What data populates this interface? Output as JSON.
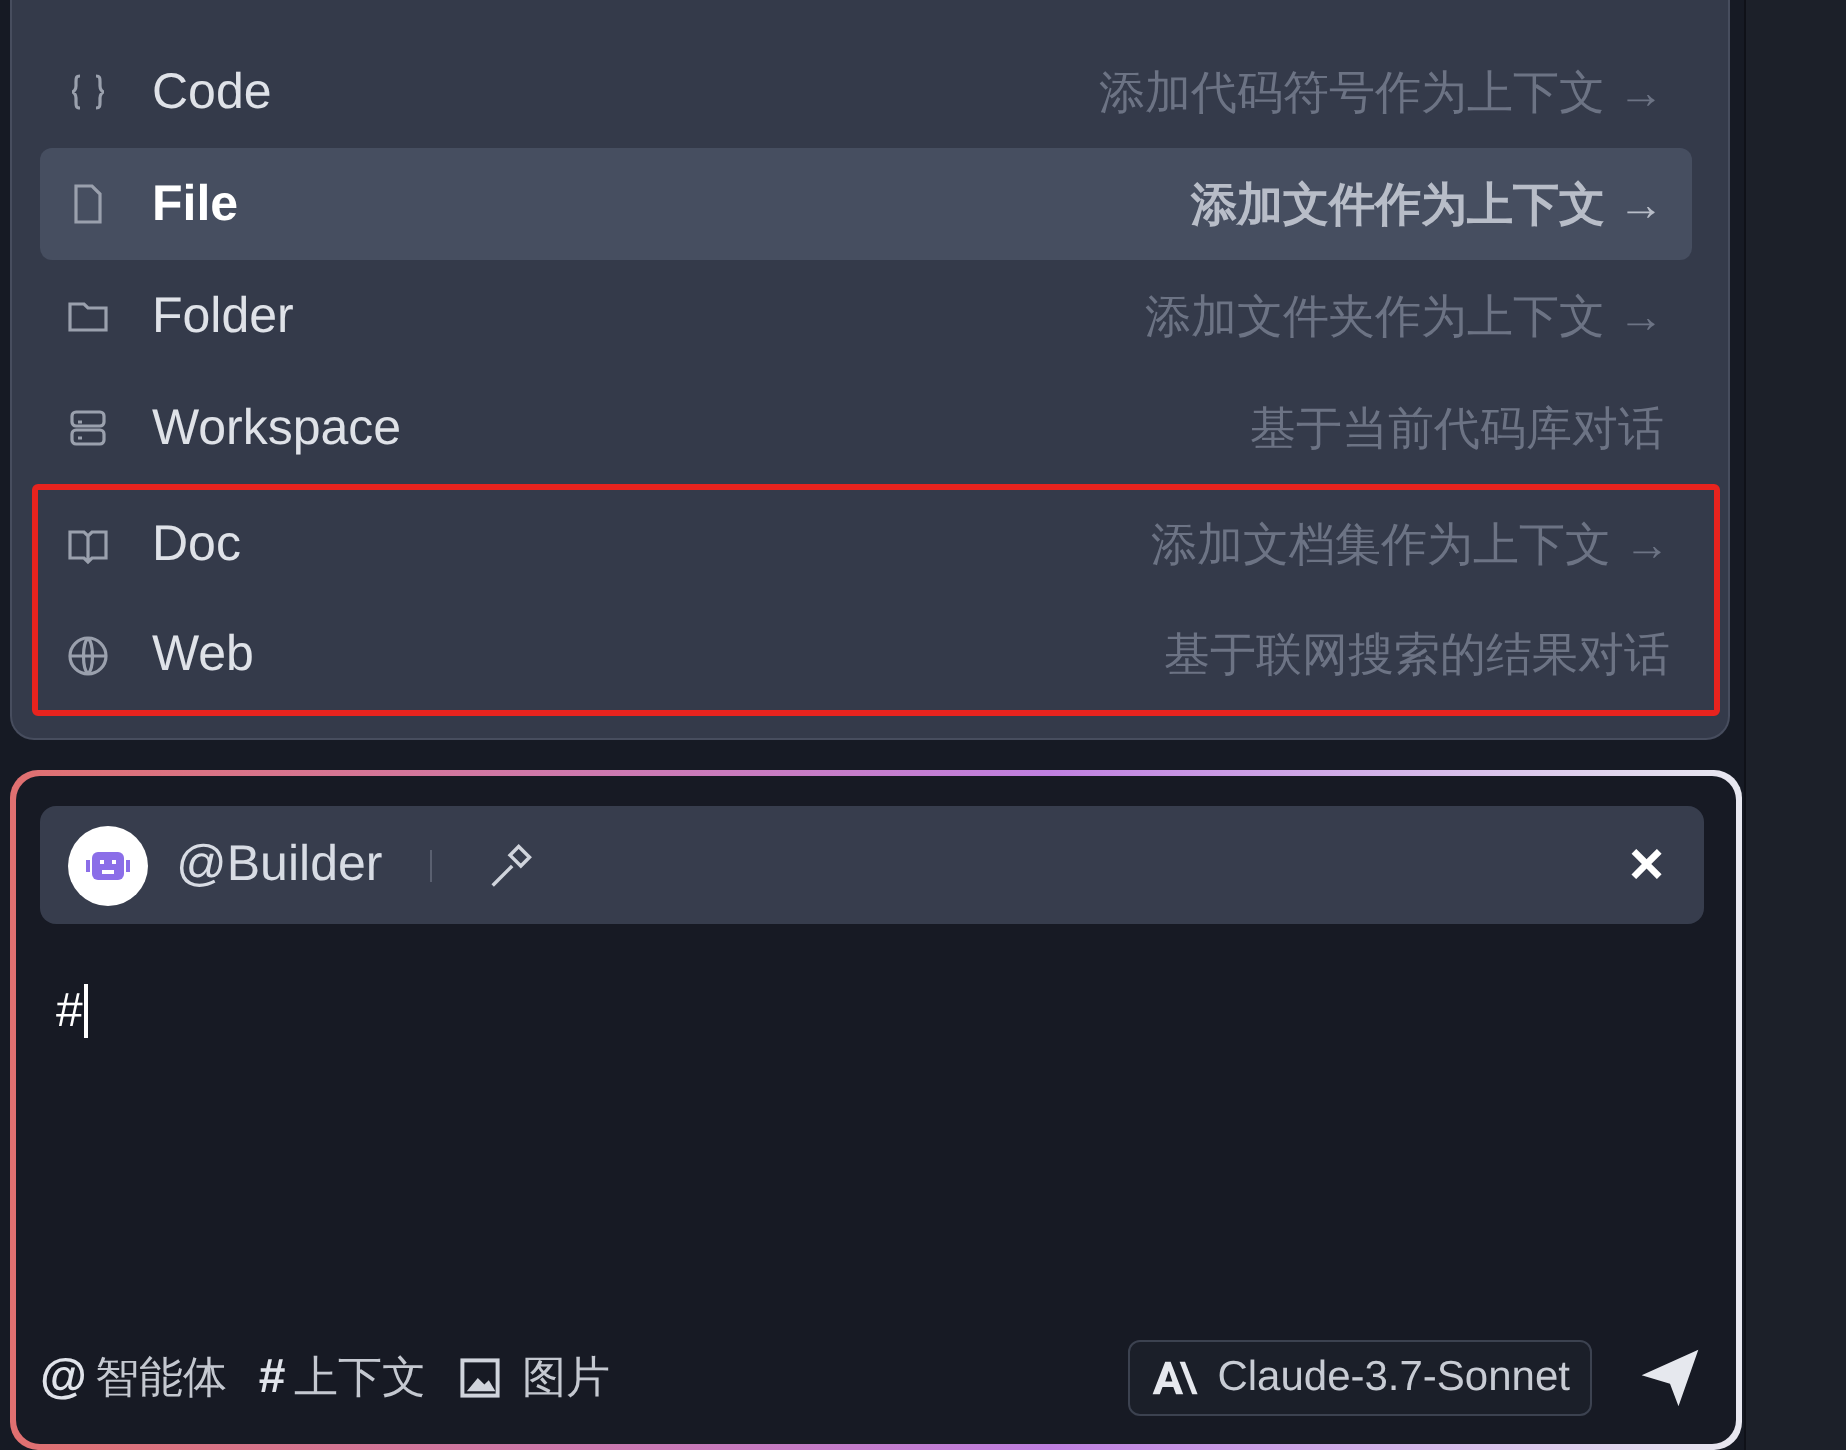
{
  "menu": {
    "items": [
      {
        "kind": "code",
        "label": "Code",
        "hint": "添加代码符号作为上下文",
        "arrow": "→",
        "selected": false,
        "highlighted": false
      },
      {
        "kind": "file",
        "label": "File",
        "hint": "添加文件作为上下文",
        "arrow": "→",
        "selected": true,
        "highlighted": false
      },
      {
        "kind": "folder",
        "label": "Folder",
        "hint": "添加文件夹作为上下文",
        "arrow": "→",
        "selected": false,
        "highlighted": false
      },
      {
        "kind": "workspace",
        "label": "Workspace",
        "hint": "基于当前代码库对话",
        "selected": false,
        "highlighted": false
      },
      {
        "kind": "doc",
        "label": "Doc",
        "hint": "添加文档集作为上下文",
        "arrow": "→",
        "selected": false,
        "highlighted": true
      },
      {
        "kind": "web",
        "label": "Web",
        "hint": "基于联网搜索的结果对话",
        "selected": false,
        "highlighted": true
      }
    ]
  },
  "composer": {
    "agent": {
      "name": "@Builder",
      "close": "×"
    },
    "value": "#",
    "tools": [
      {
        "kind": "agent",
        "symbol": "@",
        "label": "智能体"
      },
      {
        "kind": "context",
        "symbol": "#",
        "label": "上下文"
      },
      {
        "kind": "image",
        "label": "图片"
      }
    ],
    "model": "Claude-3.7-Sonnet"
  }
}
